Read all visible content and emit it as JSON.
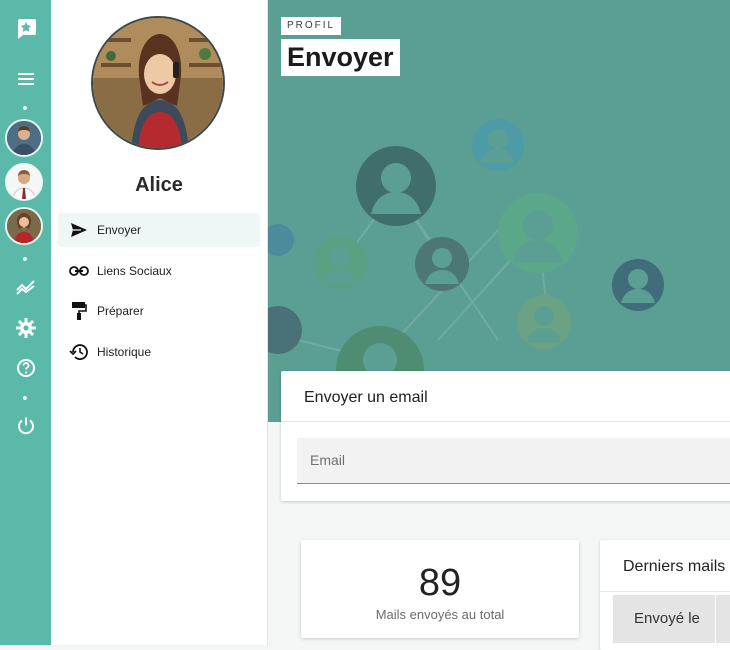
{
  "colors": {
    "rail": "#5ab9a8",
    "hero": "#5b9f94",
    "accent": "#4fb39f"
  },
  "rail": {
    "icons": [
      "app-logo-icon",
      "menu-icon",
      "chart-trend-icon",
      "gear-icon",
      "help-icon",
      "power-icon"
    ],
    "avatars": [
      "user-avatar-1",
      "user-avatar-2",
      "user-avatar-3"
    ]
  },
  "profile": {
    "name": "Alice"
  },
  "nav": [
    {
      "label": "Envoyer",
      "icon": "send-icon",
      "active": true
    },
    {
      "label": "Liens Sociaux",
      "icon": "link-icon",
      "active": false
    },
    {
      "label": "Préparer",
      "icon": "paint-roller-icon",
      "active": false
    },
    {
      "label": "Historique",
      "icon": "history-icon",
      "active": false
    }
  ],
  "header": {
    "breadcrumb": "PROFIL",
    "title": "Envoyer"
  },
  "email_card": {
    "title": "Envoyer un email",
    "placeholder": "Email",
    "value": ""
  },
  "stats": {
    "count": "89",
    "label": "Mails envoyés au total"
  },
  "last_mails": {
    "title": "Derniers mails",
    "column": "Envoyé le"
  }
}
